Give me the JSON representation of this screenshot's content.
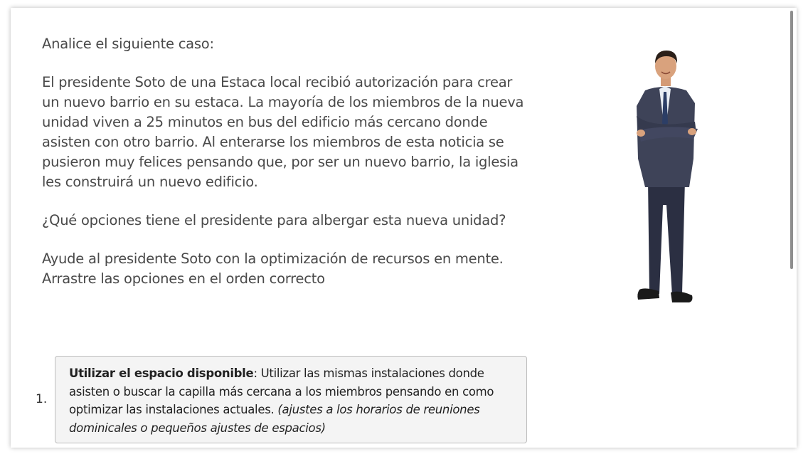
{
  "question": {
    "intro": "Analice el siguiente caso:",
    "case_text": "El presidente Soto de una Estaca local recibió autorización para crear un nuevo barrio en su estaca. La mayoría de los miembros de la nueva unidad viven a 25 minutos en bus del edificio más cercano donde asisten con otro barrio. Al enterarse los miembros de esta noticia se pusieron muy felices pensando que, por ser un nuevo barrio, la iglesia les construirá un nuevo edificio.",
    "prompt": "¿Qué opciones tiene el presidente para albergar esta nueva unidad?",
    "help_line": "Ayude al presidente Soto con la optimización de recursos en mente.",
    "instruction": "Arrastre las opciones en el orden correcto"
  },
  "options": [
    {
      "number": "1.",
      "title": "Utilizar el espacio disponible",
      "separator": ": ",
      "body": "Utilizar las mismas instalaciones donde asisten o buscar la capilla más cercana a los miembros pensando en como optimizar las instalaciones actuales. ",
      "note": "(ajustes a los horarios de reuniones dominicales o pequeños ajustes de espacios)"
    }
  ],
  "figure_icon": "businessman-illustration",
  "colors": {
    "text": "#494949",
    "option_bg": "#f4f4f4",
    "option_border": "#bdbdbd",
    "scrollbar": "#8e8e8e"
  }
}
